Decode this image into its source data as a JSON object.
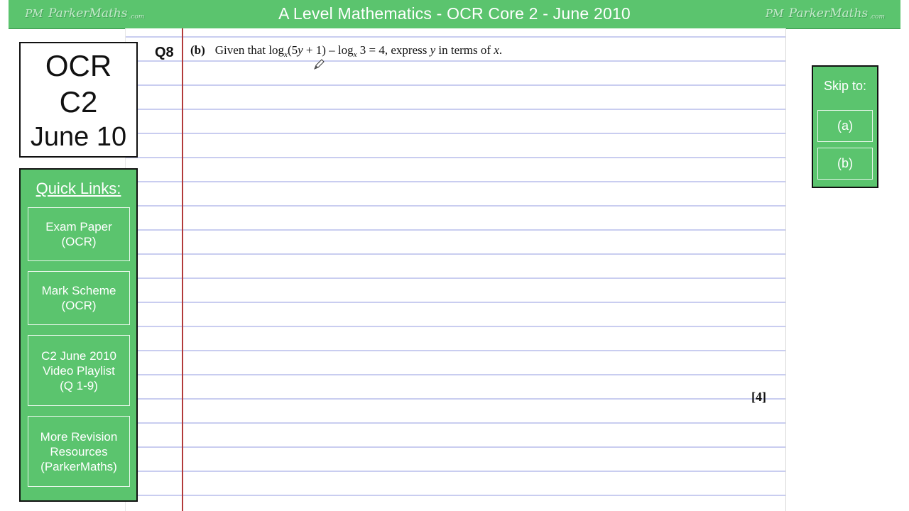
{
  "banner": {
    "title": "A Level Mathematics - OCR Core 2 - June 2010",
    "brand_left": "ParkerMaths",
    "brand_right": "ParkerMaths",
    "brand_mono": "PM",
    "brand_suffix": ".com"
  },
  "title_box": {
    "line1": "OCR",
    "line2": "C2",
    "line3": "June 10"
  },
  "quick_links": {
    "title": "Quick Links:",
    "items": [
      {
        "label": "Exam Paper\n(OCR)"
      },
      {
        "label": "Mark Scheme\n(OCR)"
      },
      {
        "label": "C2 June 2010\nVideo Playlist\n(Q 1-9)"
      },
      {
        "label": "More Revision\nResources\n(ParkerMaths)"
      }
    ]
  },
  "skip": {
    "title": "Skip to:",
    "buttons": [
      {
        "label": "(a)"
      },
      {
        "label": "(b)"
      }
    ]
  },
  "question": {
    "number": "Q8",
    "part": "(b)",
    "text_given": "Given that log",
    "base1": "x",
    "arg1": "(5",
    "var_y": "y",
    "arg1_end": " + 1) – log",
    "base2": "x",
    "tail": " 3 = 4, express ",
    "var_y2": "y",
    "tail2": " in terms of ",
    "var_x": "x",
    "end": ".",
    "marks": "[4]"
  },
  "colors": {
    "accent_green": "#5bc46e",
    "margin_red": "#b23a3a",
    "rule_blue": "#c9cdf0"
  }
}
